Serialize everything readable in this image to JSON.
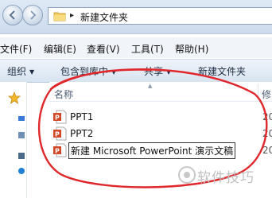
{
  "address": {
    "breadcrumb_arrow": "▸",
    "path": "新建文件夹"
  },
  "menu": [
    {
      "label": "文件(F)"
    },
    {
      "label": "编辑(E)"
    },
    {
      "label": "查看(V)"
    },
    {
      "label": "工具(T)"
    },
    {
      "label": "帮助(H)"
    }
  ],
  "toolbar": {
    "organize": "组织",
    "include_library": "包含到库中",
    "share": "共享",
    "new_folder": "新建文件夹"
  },
  "columns": {
    "name": "名称",
    "modified": "修"
  },
  "files": [
    {
      "name": "PPT1",
      "date": "20",
      "icon": "powerpoint-file-icon"
    },
    {
      "name": "PPT2",
      "date": "20",
      "icon": "powerpoint-file-icon"
    },
    {
      "name": "新建 Microsoft PowerPoint 演示文稿",
      "date": "20",
      "icon": "powerpoint-file-icon"
    }
  ],
  "annotation_color": "#e0272b",
  "watermark": {
    "text": "软件技巧"
  }
}
